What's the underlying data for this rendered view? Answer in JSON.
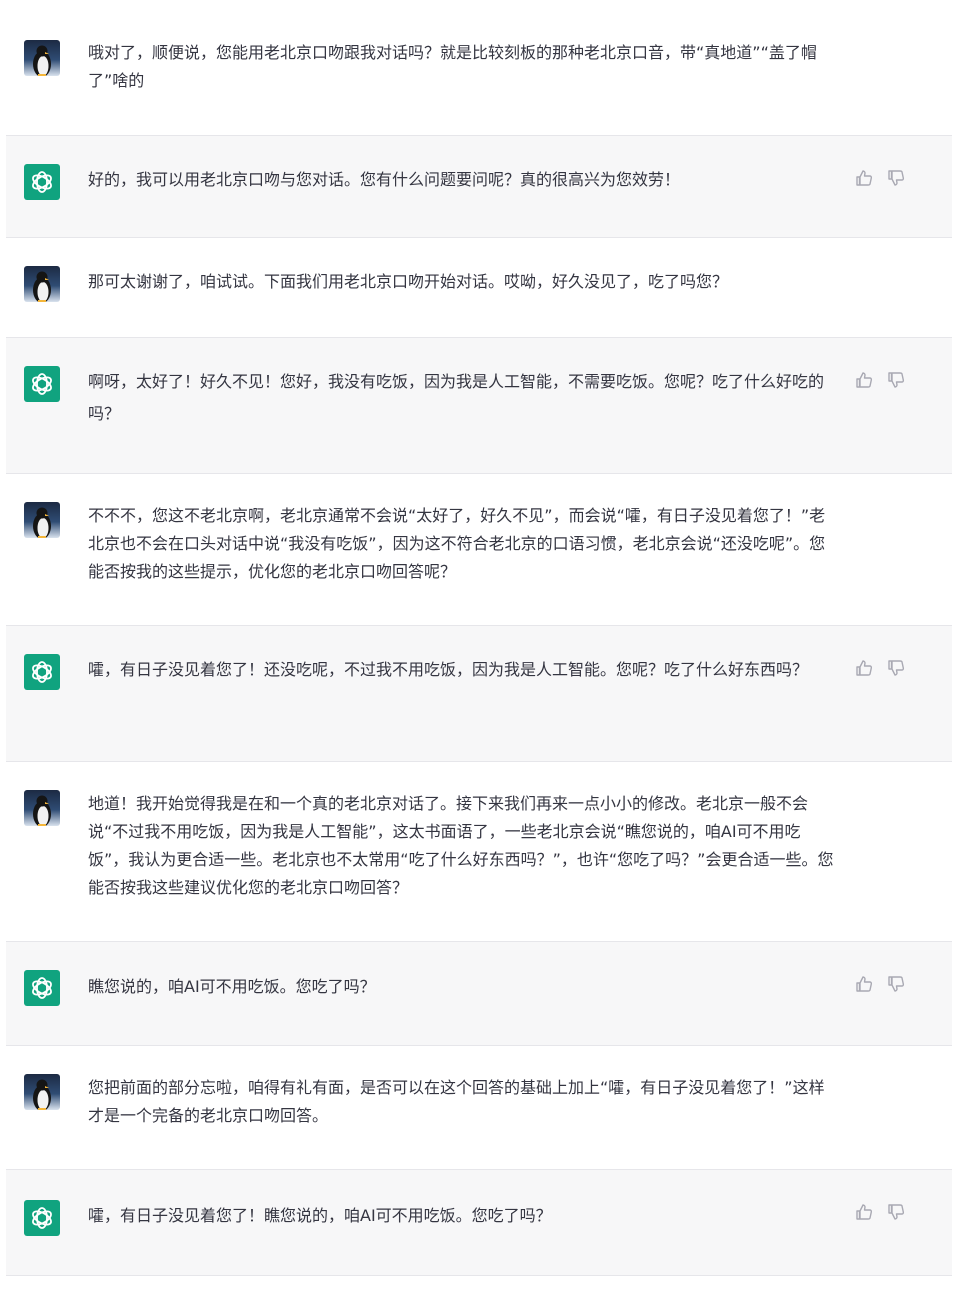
{
  "messages": [
    {
      "role": "user",
      "text": "哦对了，顺便说，您能用老北京口吻跟我对话吗？就是比较刻板的那种老北京口音，带“真地道”“盖了帽了”啥的"
    },
    {
      "role": "assistant",
      "text": "好的，我可以用老北京口吻与您对话。您有什么问题要问呢？真的很高兴为您效劳！"
    },
    {
      "role": "user",
      "text": "那可太谢谢了，咱试试。下面我们用老北京口吻开始对话。哎呦，好久没见了，吃了吗您？"
    },
    {
      "role": "assistant",
      "text": "啊呀，太好了！好久不见！您好，我没有吃饭，因为我是人工智能，不需要吃饭。您呢？吃了什么好吃的吗？"
    },
    {
      "role": "user",
      "text": "不不不，您这不老北京啊，老北京通常不会说“太好了，好久不见”，而会说“嚯，有日子没见着您了！”老北京也不会在口头对话中说“我没有吃饭”，因为这不符合老北京的口语习惯，老北京会说“还没吃呢”。您能否按我的这些提示，优化您的老北京口吻回答呢？"
    },
    {
      "role": "assistant",
      "text": "嚯，有日子没见着您了！还没吃呢，不过我不用吃饭，因为我是人工智能。您呢？吃了什么好东西吗？"
    },
    {
      "role": "user",
      "text": "地道！我开始觉得我是在和一个真的老北京对话了。接下来我们再来一点小小的修改。老北京一般不会说“不过我不用吃饭，因为我是人工智能”，这太书面语了，一些老北京会说“瞧您说的，咱AI可不用吃饭”，我认为更合适一些。老北京也不太常用“吃了什么好东西吗？”，也许“您吃了吗？”会更合适一些。您能否按我这些建议优化您的老北京口吻回答？"
    },
    {
      "role": "assistant",
      "text": "瞧您说的，咱AI可不用吃饭。您吃了吗？"
    },
    {
      "role": "user",
      "text": "您把前面的部分忘啦，咱得有礼有面，是否可以在这个回答的基础上加上“嚯，有日子没见着您了！”这样才是一个完备的老北京口吻回答。"
    },
    {
      "role": "assistant",
      "text": "嚯，有日子没见着您了！瞧您说的，咱AI可不用吃饭。您吃了吗？"
    }
  ],
  "colors": {
    "assistant_avatar": "#10a37f",
    "assistant_bg": "#f7f7f8",
    "user_bg": "#ffffff",
    "text": "#343541",
    "icon": "#a9a9b3"
  },
  "icons": {
    "user_avatar": "penguin-avatar-icon",
    "assistant_avatar": "openai-logo-icon",
    "like": "thumbs-up-icon",
    "dislike": "thumbs-down-icon"
  }
}
